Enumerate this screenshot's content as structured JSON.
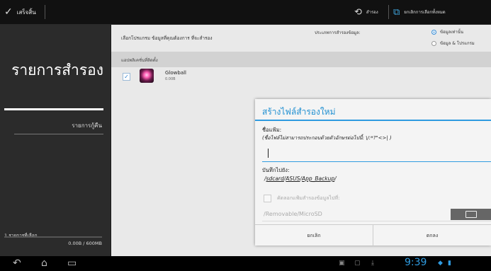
{
  "topbar": {
    "done_label": "เสร็จสิ้น",
    "restore_label": "สำรอง",
    "unselect_all_label": "ยกเลิกการเลือกทั้งหมด"
  },
  "left_panel": {
    "title": "รายการสำรอง",
    "item_label": "รายการกู้คืน",
    "selected_count": "1 รายการที่เลือก",
    "size_used": "0.00B / 600MB",
    "selected_fraction": 0.0
  },
  "main": {
    "choose_text": "เลือกโปรแกรม ข้อมูลที่คุณต้องการ ที่จะสำรอง",
    "backup_type_label": "ประเภทการสำรองข้อมูล:",
    "radio_options": [
      {
        "label": "ข้อมูลเท่านั้น",
        "selected": true
      },
      {
        "label": "ข้อมูล & โปรแกรม",
        "selected": false
      }
    ],
    "installed_header": "แอปพลิเคชั่นที่ติดตั้ง",
    "apps": [
      {
        "name": "Glowball",
        "size": "0.00B",
        "checked": true
      }
    ]
  },
  "dialog": {
    "title": "สร้างไฟล์สำรองใหม่",
    "file_name_label": "ชื่อแฟ้ม:",
    "file_name_hint": "(ชื่อไฟล์ไม่สามารถประกอบด้วยตัวอักษรต่อไปนี้: \\/:*?\"<>| )",
    "file_name_value": "",
    "save_to_label": "บันทึกไปยัง:",
    "save_path": {
      "sep": "/",
      "p1": "sdcard",
      "p2": "ASUS",
      "p3": "App_Backup"
    },
    "copy_label": "คัดลอกแฟ้มสำรองข้อมูลไปที่:",
    "copy_path": "/Removable/MicroSD",
    "cancel_label": "ยกเลิก",
    "ok_label": "ตกลง"
  },
  "statusbar": {
    "time": "9:39"
  },
  "colors": {
    "accent": "#2f9be0",
    "dialog_title": "#1f8fd1"
  }
}
